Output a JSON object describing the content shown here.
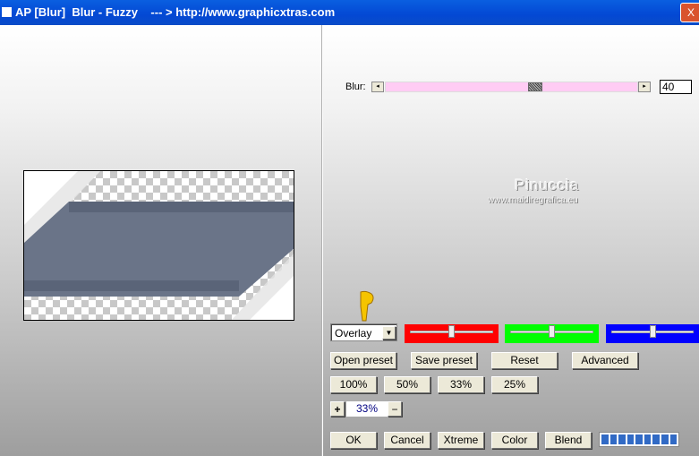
{
  "window": {
    "title": "AP [Blur]  Blur - Fuzzy    --- > http://www.graphicxtras.com",
    "close": "X"
  },
  "blur": {
    "label": "Blur:",
    "value": "40",
    "fraction": 0.6
  },
  "watermark": {
    "name": "Pinuccia",
    "url": "www.maidiregrafica.eu"
  },
  "blend_mode": {
    "selected": "Overlay"
  },
  "color_sliders": [
    {
      "name": "red",
      "color": "#ff0000",
      "fraction": 0.5
    },
    {
      "name": "green",
      "color": "#00ff00",
      "fraction": 0.5
    },
    {
      "name": "blue",
      "color": "#0000ff",
      "fraction": 0.5
    }
  ],
  "preset_buttons": [
    "Open preset",
    "Save preset",
    "Reset",
    "Advanced"
  ],
  "zoom_buttons": [
    "100%",
    "50%",
    "33%",
    "25%"
  ],
  "zoom": {
    "plus": "+",
    "value": "33%",
    "minus": "−"
  },
  "action_buttons": [
    "OK",
    "Cancel",
    "Xtreme",
    "Color",
    "Blend"
  ],
  "progress": {
    "segments": 9,
    "color": "#316ac5"
  }
}
